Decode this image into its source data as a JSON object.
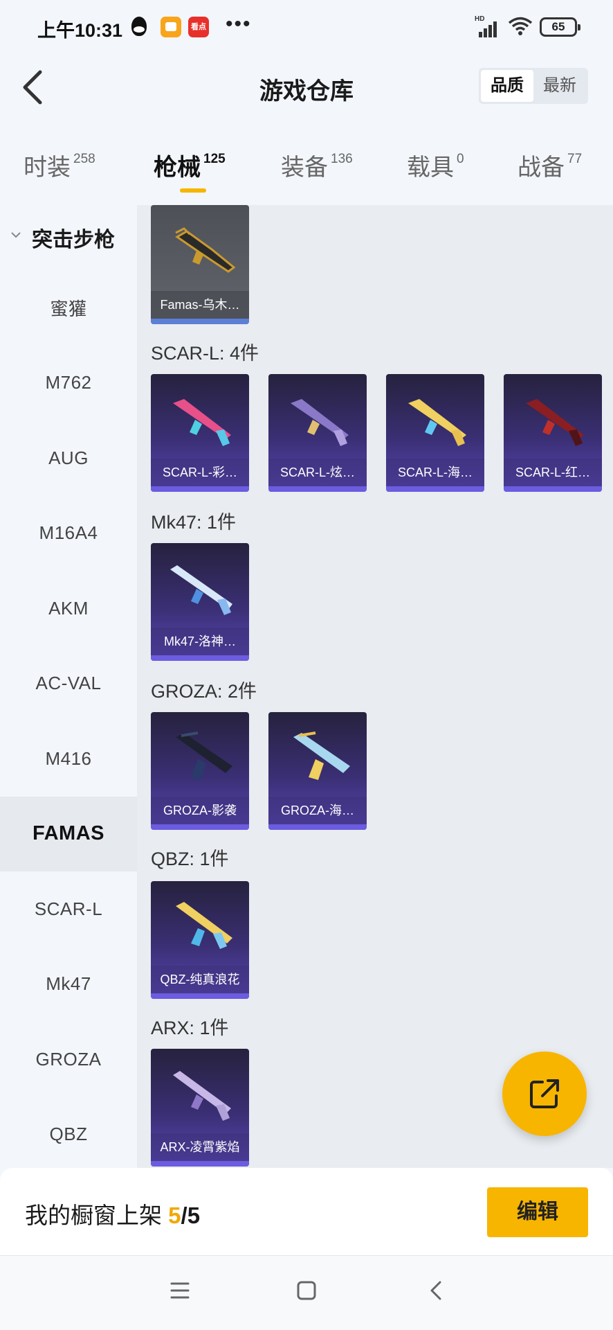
{
  "status_bar": {
    "time": "上午10:31",
    "app_badge": "看点",
    "more": "•••",
    "network": "HD",
    "battery": "65"
  },
  "header": {
    "title": "游戏仓库",
    "sort_options": [
      "品质",
      "最新"
    ],
    "active_sort": "品质"
  },
  "tabs": [
    {
      "label": "时装",
      "count": "258"
    },
    {
      "label": "枪械",
      "count": "125",
      "active": true
    },
    {
      "label": "装备",
      "count": "136"
    },
    {
      "label": "载具",
      "count": "0"
    },
    {
      "label": "战备",
      "count": "77"
    }
  ],
  "sidebar": {
    "group": "突击步枪",
    "items": [
      "蜜獾",
      "M762",
      "AUG",
      "M16A4",
      "AKM",
      "AC-VAL",
      "M416",
      "FAMAS",
      "SCAR-L",
      "Mk47",
      "GROZA",
      "QBZ"
    ],
    "active": "FAMAS"
  },
  "content": {
    "famas_card": "Famas-乌木…",
    "groups": [
      {
        "label": "SCAR-L: 4件",
        "items": [
          "SCAR-L-彩…",
          "SCAR-L-炫…",
          "SCAR-L-海…",
          "SCAR-L-红…"
        ]
      },
      {
        "label": "Mk47: 1件",
        "items": [
          "Mk47-洛神…"
        ]
      },
      {
        "label": "GROZA: 2件",
        "items": [
          "GROZA-影袭",
          "GROZA-海…"
        ]
      },
      {
        "label": "QBZ: 1件",
        "items": [
          "QBZ-纯真浪花"
        ]
      },
      {
        "label": "ARX: 1件",
        "items": [
          "ARX-凌霄紫焰"
        ]
      }
    ]
  },
  "bottom": {
    "label": "我的橱窗上架",
    "count": "5",
    "total": "/5",
    "edit": "编辑"
  },
  "colors": {
    "accent": "#f7b500",
    "card_purple": "#3a2f74",
    "card_gray": "#5d5f67"
  }
}
